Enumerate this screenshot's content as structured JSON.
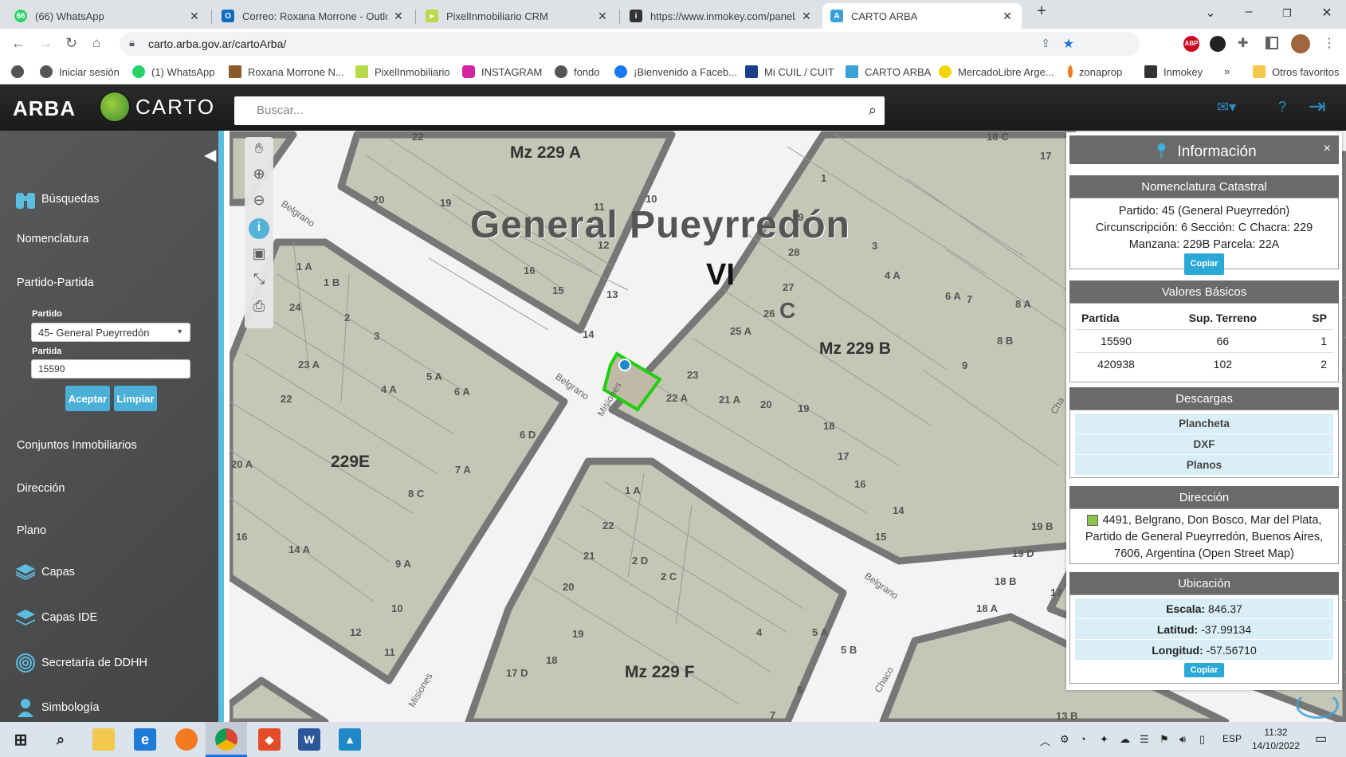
{
  "browser": {
    "tabs": [
      {
        "title": "(66) WhatsApp",
        "icon": "whatsapp-icon",
        "color": "#25d366",
        "badge": "66"
      },
      {
        "title": "Correo: Roxana Morrone - Outloo",
        "icon": "outlook-icon",
        "color": "#0f6cbd"
      },
      {
        "title": "PixelInmobiliario CRM",
        "icon": "flag-icon",
        "color": "#b7d94a"
      },
      {
        "title": "https://www.inmokey.com/panel/",
        "icon": "inmokey-icon",
        "color": "#333"
      },
      {
        "title": "CARTO ARBA",
        "icon": "carto-icon",
        "color": "#3aa0d8"
      }
    ],
    "new_tab": "+",
    "url": "carto.arba.gov.ar/cartoArba/",
    "bookmarks": [
      {
        "label": "Iniciar sesión",
        "color": "#555"
      },
      {
        "label": "(1) WhatsApp",
        "color": "#25d366"
      },
      {
        "label": "Roxana Morrone N...",
        "color": "#8b5a2b"
      },
      {
        "label": "PixelInmobiliario",
        "color": "#b7d94a"
      },
      {
        "label": "INSTAGRAM",
        "color": "#d6249f"
      },
      {
        "label": "fondo",
        "color": "#555"
      },
      {
        "label": "¡Bienvenido a Faceb...",
        "color": "#1877f2"
      },
      {
        "label": "Mi CUIL / CUIT",
        "color": "#1b3f8b"
      },
      {
        "label": "CARTO ARBA",
        "color": "#3aa0d8"
      },
      {
        "label": "MercadoLibre Arge...",
        "color": "#f5d300"
      },
      {
        "label": "zonaprop",
        "color": "#f47a20"
      },
      {
        "label": "Inmokey",
        "color": "#333"
      }
    ],
    "more": "»",
    "other_favorites": "Otros favoritos"
  },
  "app": {
    "logo_arba": "ARBA",
    "logo_carto": "CARTO",
    "search_placeholder": "Buscar..."
  },
  "sidebar": {
    "busquedas": "Búsquedas",
    "nomenclatura": "Nomenclatura",
    "partido_partida": "Partido-Partida",
    "partido_label": "Partido",
    "partido_value": "45- General Pueyrredón",
    "partida_label": "Partida",
    "partida_value": "15590",
    "aceptar": "Aceptar",
    "limpiar": "Limpiar",
    "conjuntos": "Conjuntos Inmobiliarios",
    "direccion": "Dirección",
    "plano": "Plano",
    "capas": "Capas",
    "capas_ide": "Capas IDE",
    "secretaria": "Secretaría de DDHH",
    "simbologia": "Simbología"
  },
  "map": {
    "title": "General Pueyrredón",
    "circ": "VI",
    "sec": "C",
    "manzanas": [
      "Mz 229 A",
      "Mz 229 B",
      "229E",
      "Mz 229 F"
    ],
    "streets": [
      "Belgrano",
      "Belgrano",
      "Belgrano",
      "Misiones",
      "Misiones",
      "Chaco",
      "Cha"
    ],
    "parcels_a": [
      "22",
      "20",
      "19",
      "11",
      "10",
      "12",
      "16",
      "15",
      "13",
      "14"
    ],
    "parcels_b": [
      "1",
      "29",
      "28",
      "3",
      "4 A",
      "27",
      "26",
      "25 A",
      "23",
      "22 A",
      "21 A",
      "20",
      "19",
      "18",
      "17",
      "16",
      "14",
      "15",
      "9",
      "8 B",
      "8 A",
      "7",
      "6 A"
    ],
    "parcels_e": [
      "1 A",
      "1 B",
      "24",
      "2",
      "3",
      "23 A",
      "22",
      "4 A",
      "5 A",
      "6 A",
      "6 D",
      "7 A",
      "8 C",
      "20 A",
      "16",
      "14 A",
      "9 A",
      "10",
      "12",
      "11"
    ],
    "parcels_f": [
      "1 A",
      "22",
      "21",
      "2 D",
      "2 C",
      "20",
      "19",
      "18",
      "17 D",
      "4",
      "5 A",
      "5 B",
      "6",
      "7"
    ],
    "parcels_r": [
      "18 C",
      "17",
      "19 B",
      "19 D",
      "18 B",
      "17",
      "18 A",
      "13 B"
    ]
  },
  "panel": {
    "title": "Información",
    "close": "×",
    "nomenclatura_title": "Nomenclatura Catastral",
    "nom_line1": "Partido: 45 (General Pueyrredón)",
    "nom_line2": "Circunscripción: 6 Sección: C Chacra: 229",
    "nom_line3": "Manzana: 229B Parcela: 22A",
    "copiar": "Copiar",
    "valores_title": "Valores Básicos",
    "valores_headers": [
      "Partida",
      "Sup. Terreno",
      "SP"
    ],
    "valores_rows": [
      [
        "15590",
        "66",
        "1"
      ],
      [
        "420938",
        "102",
        "2"
      ]
    ],
    "descargas_title": "Descargas",
    "descargas": [
      "Plancheta",
      "DXF",
      "Planos"
    ],
    "direccion_title": "Dirección",
    "direccion_text": "4491, Belgrano, Don Bosco, Mar del Plata, Partido de General Pueyrredón, Buenos Aires, 7606, Argentina (Open Street Map)",
    "ubicacion_title": "Ubicación",
    "escala_label": "Escala:",
    "escala_value": "846.37",
    "latitud_label": "Latitud:",
    "latitud_value": "-37.99134",
    "longitud_label": "Longitud:",
    "longitud_value": "-57.56710",
    "copiar2": "Copiar"
  },
  "taskbar": {
    "lang": "ESP",
    "time": "11:32",
    "date": "14/10/2022"
  }
}
